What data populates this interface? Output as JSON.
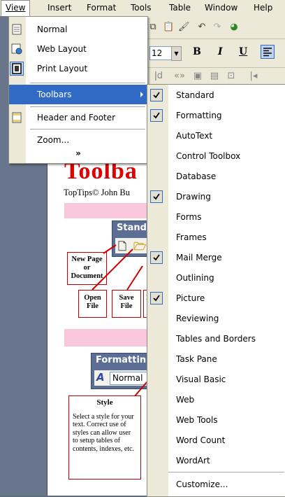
{
  "menubar": {
    "items": [
      "View",
      "Insert",
      "Format",
      "Tools",
      "Table",
      "Window",
      "Help"
    ],
    "active": "View"
  },
  "toolbar": {
    "font_size": "12",
    "bold": "B",
    "italic": "I",
    "underline": "U"
  },
  "document": {
    "title": "Toolba",
    "subtitle": "TopTips© John Bu",
    "standard_toolbar_label": "Standa",
    "formatting_toolbar_label": "Formattin",
    "style_box_value": "Normal",
    "callouts": {
      "new_page": "New Page or Document",
      "open_file": "Open File",
      "save_file": "Save File",
      "partial": "I"
    },
    "style_callout": {
      "heading": "Style",
      "body": "Select a style for your text. Correct use of styles can allow user to setup tables of contents, indexes, etc."
    }
  },
  "view_menu": {
    "items": [
      {
        "label": "Normal",
        "accel": "N",
        "icon": "normal-view-icon"
      },
      {
        "label": "Web Layout",
        "accel": "W",
        "icon": "web-layout-icon"
      },
      {
        "label": "Print Layout",
        "accel": "P",
        "icon": "print-layout-icon"
      },
      {
        "label": "Toolbars",
        "accel": "T",
        "icon": "",
        "submenu": true,
        "highlighted": true
      },
      {
        "label": "Header and Footer",
        "accel": "H",
        "icon": "header-footer-icon"
      },
      {
        "label": "Zoom...",
        "accel": "Z",
        "icon": ""
      }
    ],
    "expand_glyph": "»"
  },
  "toolbars_submenu": {
    "items": [
      {
        "label": "Standard",
        "checked": true
      },
      {
        "label": "Formatting",
        "checked": true
      },
      {
        "label": "AutoText",
        "checked": false
      },
      {
        "label": "Control Toolbox",
        "checked": false
      },
      {
        "label": "Database",
        "checked": false
      },
      {
        "label": "Drawing",
        "checked": true
      },
      {
        "label": "Forms",
        "checked": false
      },
      {
        "label": "Frames",
        "checked": false
      },
      {
        "label": "Mail Merge",
        "checked": true
      },
      {
        "label": "Outlining",
        "checked": false
      },
      {
        "label": "Picture",
        "checked": true
      },
      {
        "label": "Reviewing",
        "checked": false
      },
      {
        "label": "Tables and Borders",
        "checked": false
      },
      {
        "label": "Task Pane",
        "checked": false
      },
      {
        "label": "Visual Basic",
        "checked": false
      },
      {
        "label": "Web",
        "checked": false
      },
      {
        "label": "Web Tools",
        "checked": false
      },
      {
        "label": "Word Count",
        "checked": false
      },
      {
        "label": "WordArt",
        "checked": false
      },
      {
        "label": "Customize...",
        "checked": false,
        "accel": "C"
      }
    ]
  },
  "colors": {
    "menu_highlight": "#316ac5",
    "menu_face": "#ece9d8",
    "title_red": "#e00000",
    "callout_border": "#c00000",
    "pink_band": "#f9c7dc"
  }
}
